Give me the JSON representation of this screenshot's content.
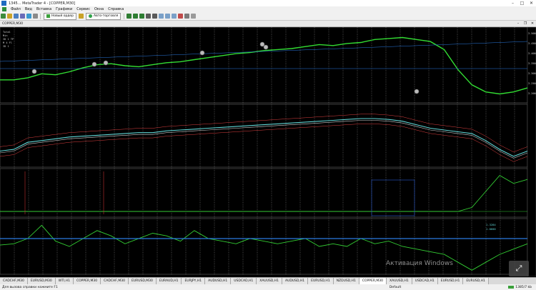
{
  "app": {
    "title": "1345... MetaTrader 4 - [COPPER,M30]"
  },
  "menu": [
    "Файл",
    "Вид",
    "Вставка",
    "Графики",
    "Сервис",
    "Окна",
    "Справка"
  ],
  "toolbar": {
    "new_order": "Новый ордер",
    "autotrading": "Авто-торговля"
  },
  "window": {
    "title": "COPPER,M30"
  },
  "chart_data": [
    {
      "type": "line",
      "title": "",
      "series": [
        {
          "name": "",
          "values": [
            3.0,
            3.0,
            3.02,
            3.06,
            3.05,
            3.08,
            3.12,
            3.15,
            3.16,
            3.14,
            3.13,
            3.15,
            3.17,
            3.18,
            3.2,
            3.22,
            3.24,
            3.26,
            3.27,
            3.29,
            3.3,
            3.31,
            3.33,
            3.35,
            3.34,
            3.36,
            3.37,
            3.4,
            3.41,
            3.42,
            3.4,
            3.38,
            3.3,
            3.1,
            2.95,
            2.88,
            2.86,
            2.88,
            2.92
          ]
        }
      ],
      "annotations": [
        "Total",
        "Min",
        "ID 1 TP",
        "M 4 Fl",
        "ID 1"
      ],
      "y_ticks": [
        "3.5000",
        "3.4500",
        "3.4000",
        "3.3500",
        "3.3000",
        "3.2500",
        "3.2000"
      ]
    },
    {
      "type": "line",
      "title": "",
      "series": [
        {
          "name": "",
          "values": [
            0.1,
            0.12,
            0.2,
            0.22,
            0.24,
            0.26,
            0.27,
            0.28,
            0.29,
            0.3,
            0.31,
            0.31,
            0.33,
            0.34,
            0.35,
            0.36,
            0.37,
            0.38,
            0.39,
            0.4,
            0.41,
            0.42,
            0.43,
            0.44,
            0.45,
            0.46,
            0.47,
            0.47,
            0.46,
            0.44,
            0.4,
            0.36,
            0.34,
            0.32,
            0.3,
            0.22,
            0.12,
            0.04,
            0.1
          ]
        },
        {
          "name": "",
          "values": [
            0.08,
            0.1,
            0.18,
            0.2,
            0.22,
            0.24,
            0.25,
            0.26,
            0.27,
            0.28,
            0.29,
            0.29,
            0.31,
            0.32,
            0.33,
            0.34,
            0.35,
            0.36,
            0.37,
            0.38,
            0.39,
            0.4,
            0.41,
            0.42,
            0.43,
            0.44,
            0.45,
            0.45,
            0.44,
            0.42,
            0.38,
            0.34,
            0.32,
            0.3,
            0.28,
            0.2,
            0.1,
            0.02,
            0.08
          ]
        }
      ]
    },
    {
      "type": "line",
      "title": "",
      "series": [
        {
          "name": "",
          "values": [
            0,
            0,
            0,
            0,
            0,
            0,
            0,
            0,
            0,
            0,
            0,
            0,
            0,
            0,
            0,
            0,
            0,
            0,
            0,
            0,
            0,
            0,
            0,
            0,
            0,
            0,
            0,
            0,
            0,
            0,
            0,
            0,
            0,
            0,
            0.1,
            0.5,
            0.9,
            0.7,
            0.8
          ]
        }
      ]
    },
    {
      "type": "line",
      "title": "",
      "series": [
        {
          "name": "",
          "values": [
            0.05,
            0.1,
            0.3,
            0.8,
            0.2,
            0.0,
            0.3,
            0.6,
            0.4,
            0.1,
            0.3,
            0.5,
            0.4,
            0.2,
            0.6,
            0.3,
            0.2,
            0.1,
            0.3,
            0.2,
            0.1,
            0.2,
            0.3,
            0.0,
            0.1,
            0.0,
            0.3,
            0.1,
            0.2,
            0.0,
            -0.1,
            -0.2,
            -0.3,
            -0.6,
            -0.9,
            -0.6,
            -0.3,
            -0.1,
            0.1
          ]
        },
        {
          "name": "",
          "values": [
            0,
            0,
            0,
            0,
            0,
            0,
            0,
            0,
            0,
            0,
            0,
            0,
            0,
            0,
            0,
            0,
            0,
            0,
            0,
            0,
            0,
            0,
            0,
            0,
            0,
            0,
            0,
            0,
            0,
            0,
            0,
            0,
            0,
            0,
            0,
            0,
            0,
            0,
            0
          ]
        }
      ],
      "annotations": [
        "1.3284",
        "1.0600"
      ]
    }
  ],
  "tabs": [
    "CADCHF,M30",
    "EURUSD,M30",
    "WTI,H1",
    "COPPER,M30",
    "CADCHF,M30",
    "EURUSD,M30",
    "EURAUD,H1",
    "EURJPY,H1",
    "AUDUSD,H1",
    "USDCAD,H1",
    "XAUUSD,H1",
    "AUDUSD,H1",
    "EURUSD,H1",
    "NZDUSD,H1",
    "COPPER,M30",
    "XAUUSD,H1",
    "USDCAD,H1",
    "EURUSD,H1",
    "EURUSD,H1"
  ],
  "active_tab_index": 14,
  "status": {
    "left": "Для вызова справки нажмите F1",
    "middle": "Default",
    "right": "1385/7 kb"
  },
  "watermark": "Активация Windows",
  "colors": {
    "price": "#33dd33",
    "ma": "#5fd3d3",
    "band": "#e04040",
    "panel_green": "#33cc33",
    "hline": "#2a7ae0"
  }
}
